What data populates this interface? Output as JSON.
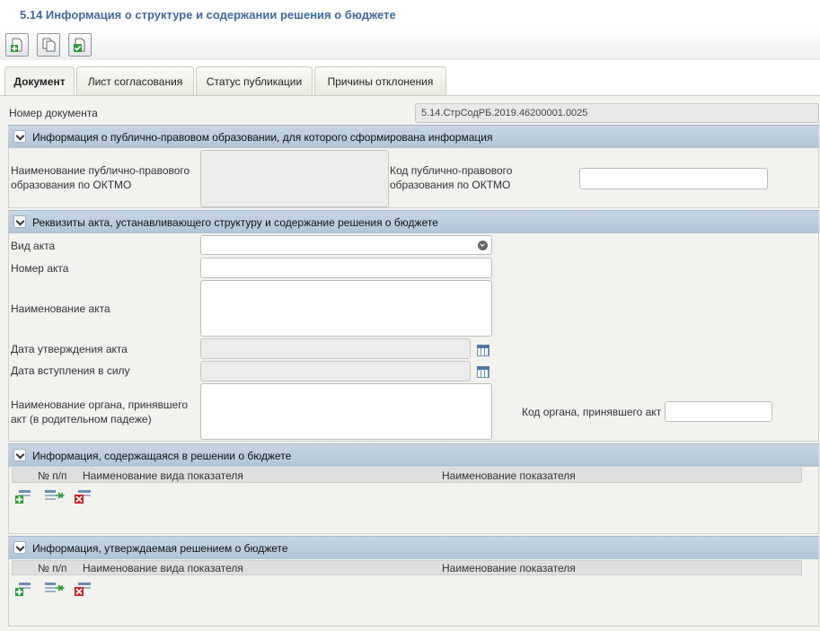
{
  "page": {
    "title": "5.14 Информация о структуре и содержании решения о бюджете"
  },
  "toolbar": {
    "buttons": [
      {
        "name": "add-document-button",
        "icon": "add-document-icon"
      },
      {
        "name": "copy-document-button",
        "icon": "copy-icon"
      },
      {
        "name": "approve-document-button",
        "icon": "check-document-icon"
      }
    ]
  },
  "tabs": [
    {
      "label": "Документ",
      "active": true
    },
    {
      "label": "Лист согласования"
    },
    {
      "label": "Статус публикации"
    },
    {
      "label": "Причины отклонения"
    }
  ],
  "document": {
    "number_label": "Номер документа",
    "number_value": "5.14.СтрСодРБ.2019.46200001.0025"
  },
  "section1": {
    "title": "Информация о публично-правовом образовании, для которого сформирована информация",
    "name_label": "Наименование публично-правового образования по ОКТМО",
    "code_label": "Код публично-правового образования по ОКТМО"
  },
  "section2": {
    "title": "Реквизиты акта, устанавливающего структуру и содержание решения о бюджете",
    "act_type_label": "Вид акта",
    "act_number_label": "Номер акта",
    "act_name_label": "Наименование акта",
    "approval_date_label": "Дата утверждения акта",
    "effective_date_label": "Дата вступления в силу",
    "org_name_label": "Наименование органа, принявшего акт (в родительном падеже)",
    "org_code_label": "Код органа, принявшего акт"
  },
  "section3": {
    "title": "Информация, содержащаяся в решении о бюджете",
    "col_num": "№ п/п",
    "col_type": "Наименование вида показателя",
    "col_name": "Наименование показателя"
  },
  "section4": {
    "title": "Информация, утверждаемая решением о бюджете",
    "col_num": "№ п/п",
    "col_type": "Наименование вида показателя",
    "col_name": "Наименование показателя"
  },
  "colors": {
    "title": "#3f6aa0",
    "section_header": "#b9cadb",
    "panel": "#f2f2ee"
  }
}
